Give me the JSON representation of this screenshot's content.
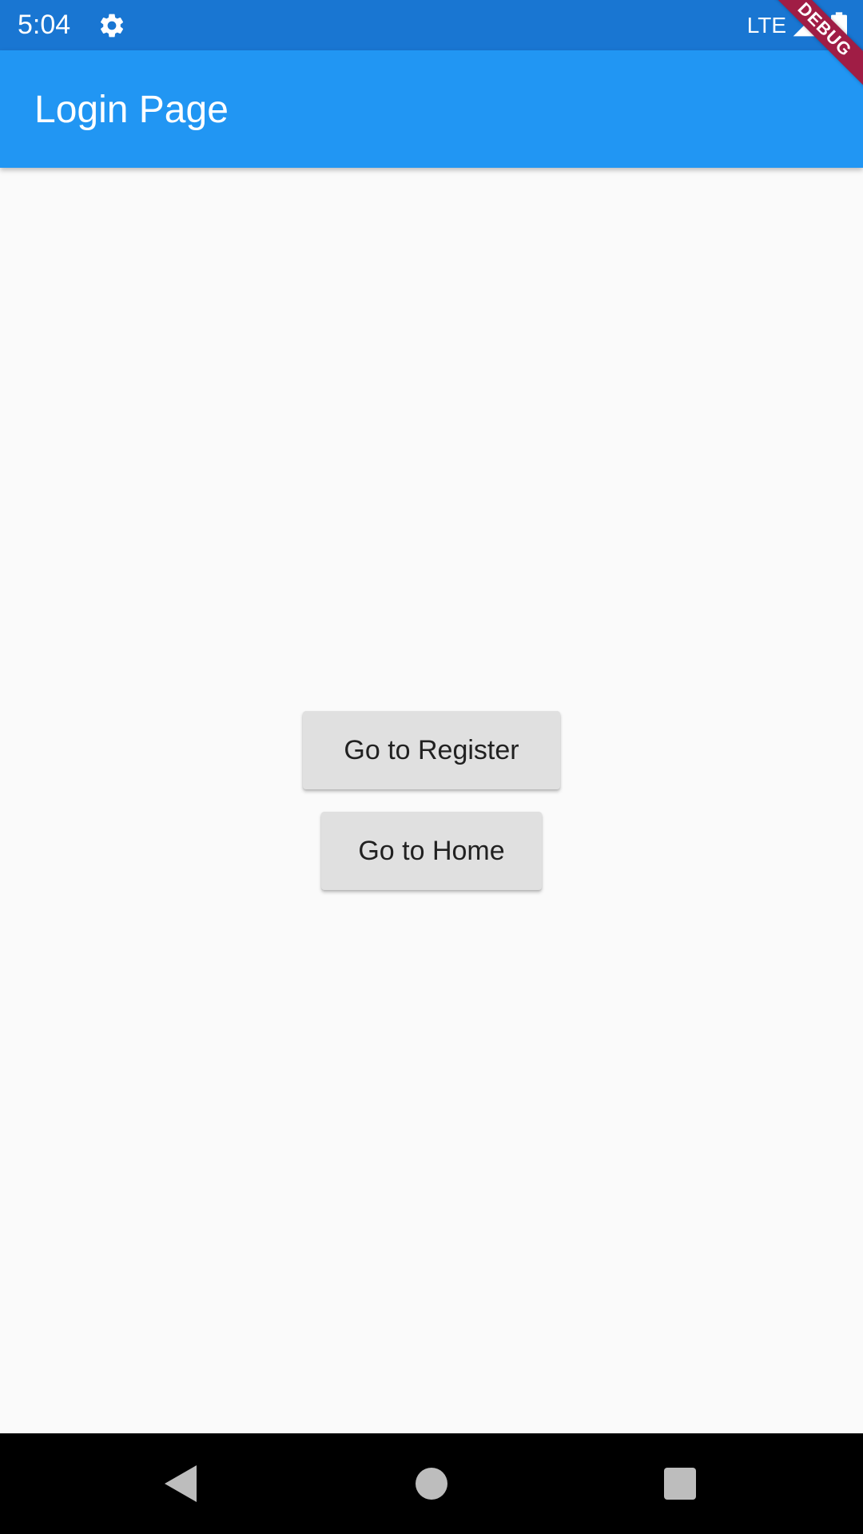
{
  "status_bar": {
    "time": "5:04",
    "network": "LTE",
    "icons": [
      "gear-icon",
      "signal-icon",
      "battery-icon"
    ]
  },
  "app_bar": {
    "title": "Login Page",
    "color": "#2196f3"
  },
  "debug_banner": {
    "label": "DEBUG",
    "color": "#a01d45"
  },
  "buttons": {
    "register_label": "Go to Register",
    "home_label": "Go to Home"
  },
  "nav_bar": {
    "icons": [
      "back-icon",
      "home-icon",
      "recents-icon"
    ]
  }
}
